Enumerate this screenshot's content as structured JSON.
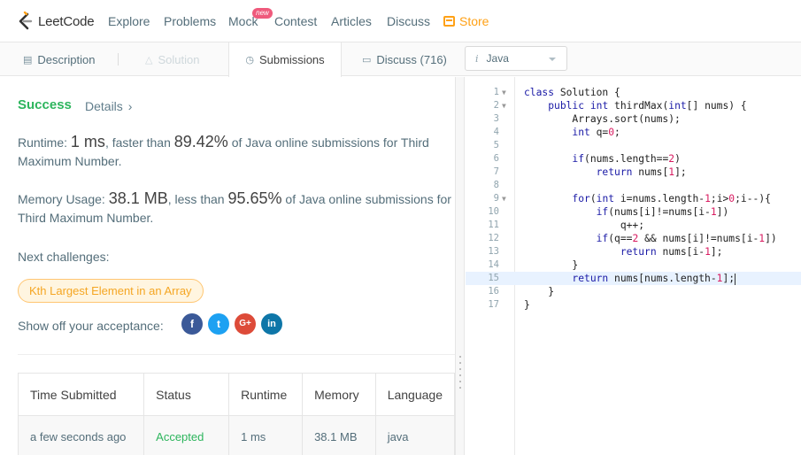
{
  "nav": {
    "logo": "LeetCode",
    "links": [
      "Explore",
      "Problems",
      "Mock",
      "Contest",
      "Articles",
      "Discuss"
    ],
    "mock_badge": "new",
    "store": "Store"
  },
  "tabs": {
    "description": "Description",
    "solution": "Solution",
    "submissions": "Submissions",
    "discuss": "Discuss (716)"
  },
  "language": {
    "icon": "i",
    "selected": "Java"
  },
  "result": {
    "status": "Success",
    "details": "Details",
    "runtime_label": "Runtime: ",
    "runtime_value": "1 ms",
    "runtime_mid": ", faster than ",
    "runtime_pct": "89.42%",
    "runtime_tail": " of Java online submissions for Third Maximum Number.",
    "memory_label": "Memory Usage: ",
    "memory_value": "38.1 MB",
    "memory_mid": ", less than ",
    "memory_pct": "95.65%",
    "memory_tail": " of Java online submissions for Third Maximum Number.",
    "next_label": "Next challenges:",
    "next_challenge": "Kth Largest Element in an Array",
    "share_label": "Show off your acceptance:",
    "share_icons": {
      "facebook": "f",
      "twitter": "t",
      "google": "G+",
      "linkedin": "in"
    }
  },
  "table": {
    "headers": [
      "Time Submitted",
      "Status",
      "Runtime",
      "Memory",
      "Language"
    ],
    "rows": [
      [
        "a few seconds ago",
        "Accepted",
        "1 ms",
        "38.1 MB",
        "java"
      ]
    ]
  },
  "editor": {
    "lines": [
      "class Solution {",
      "    public int thirdMax(int[] nums) {",
      "        Arrays.sort(nums);",
      "        int q=0;",
      "",
      "        if(nums.length==2)",
      "            return nums[1];",
      "",
      "        for(int i=nums.length-1;i>0;i--){",
      "            if(nums[i]!=nums[i-1])",
      "                q++;",
      "            if(q==2 && nums[i]!=nums[i-1])",
      "                return nums[i-1];",
      "        }",
      "        return nums[nums.length-1];",
      "    }",
      "}"
    ],
    "fold_lines": [
      1,
      2,
      9
    ],
    "active_line": 15
  },
  "colors": {
    "success": "#2db55d",
    "store": "#ffa116",
    "keyword": "#1a1aa6",
    "number": "#d81b60"
  }
}
